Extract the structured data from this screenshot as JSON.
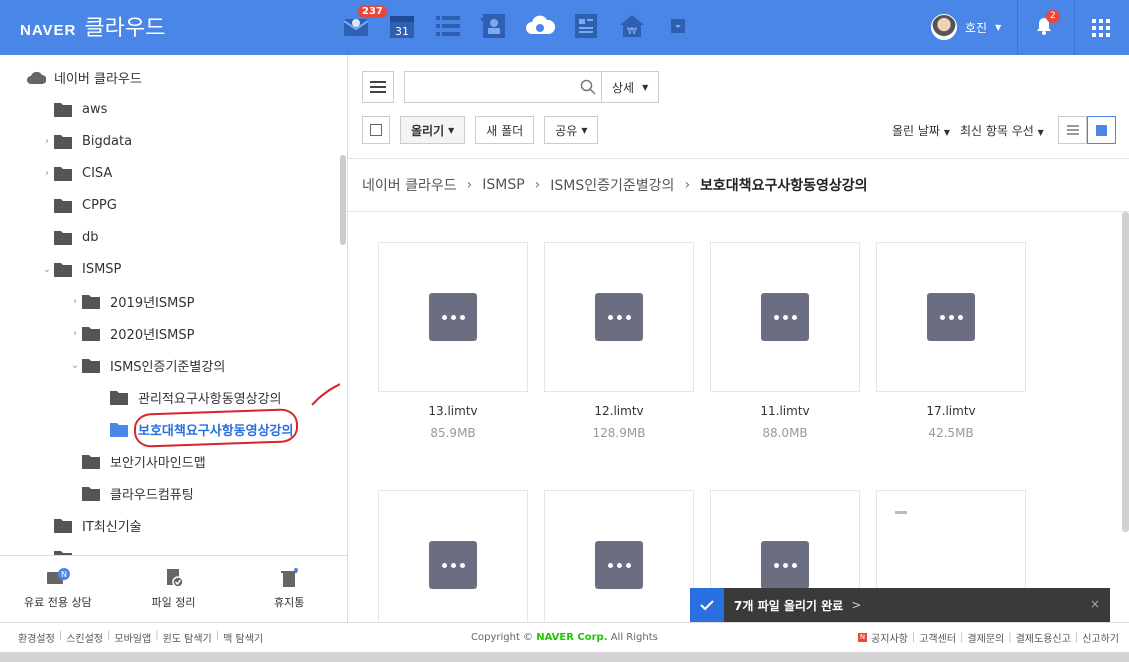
{
  "header": {
    "brand": "NAVER",
    "service": "클라우드",
    "mail_badge": "237",
    "calendar_day": "31",
    "user_name": "호진",
    "notification_badge": "2",
    "colors": {
      "bar": "#4a86e8",
      "badge": "#e8473a"
    }
  },
  "sidebar": {
    "root": "네이버 클라우드",
    "items": [
      {
        "label": "aws"
      },
      {
        "label": "Bigdata"
      },
      {
        "label": "CISA"
      },
      {
        "label": "CPPG"
      },
      {
        "label": "db"
      },
      {
        "label": "ISMSP"
      },
      {
        "label": "2019년ISMSP"
      },
      {
        "label": "2020년ISMSP"
      },
      {
        "label": "ISMS인증기준별강의"
      },
      {
        "label": "관리적요구사항동영상강의"
      },
      {
        "label": "보호대책요구사항동영상강의"
      },
      {
        "label": "보안기사마인드맵"
      },
      {
        "label": "클라우드컴퓨팅"
      },
      {
        "label": "IT최신기술"
      }
    ],
    "footer": {
      "consult": "유료 전용 상담",
      "cleanup": "파일 정리",
      "trash": "휴지통"
    }
  },
  "toolbar": {
    "search_placeholder": "",
    "detail": "상세",
    "upload": "올리기",
    "new_folder": "새 폴더",
    "share": "공유",
    "sort_date": "올린 날짜",
    "sort_order": "최신 항목 우선"
  },
  "breadcrumb": {
    "items": [
      "네이버 클라우드",
      "ISMSP",
      "ISMS인증기준별강의"
    ],
    "current": "보호대책요구사항동영상강의"
  },
  "files": [
    {
      "name": "13.limtv",
      "size": "85.9MB"
    },
    {
      "name": "12.limtv",
      "size": "128.9MB"
    },
    {
      "name": "11.limtv",
      "size": "88.0MB"
    },
    {
      "name": "17.limtv",
      "size": "42.5MB"
    }
  ],
  "toast": {
    "message": "7개 파일 올리기 완료",
    "chevron": ">",
    "close": "×"
  },
  "footer": {
    "left": [
      "환경설정",
      "스킨설정",
      "모바일앱",
      "윈도 탐색기",
      "맥 탐색기"
    ],
    "copyright_prefix": "Copyright ©",
    "copyright_corp": "NAVER Corp.",
    "copyright_suffix": "All Rights",
    "notice_mark": "N",
    "right": [
      "공지사항",
      "고객센터",
      "결제문의",
      "결제도용신고",
      "신고하기"
    ]
  }
}
